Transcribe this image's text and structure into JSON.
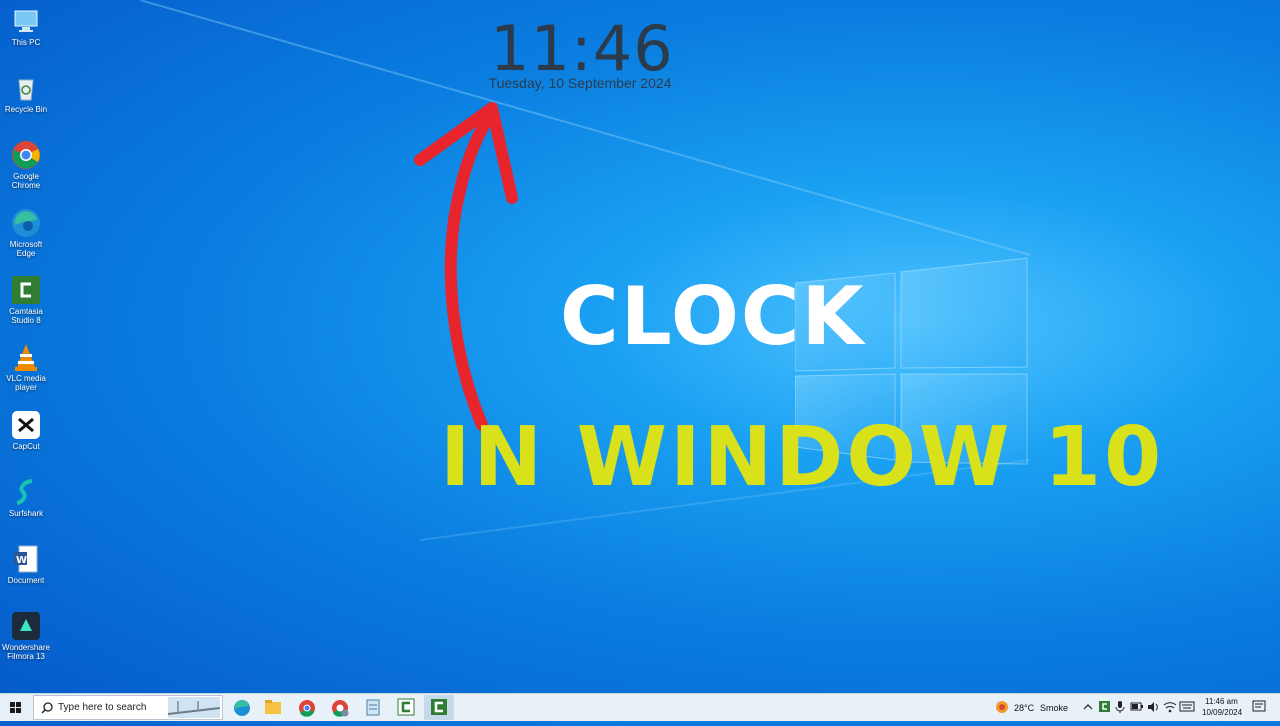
{
  "desktop": {
    "icons": [
      {
        "label": "This PC",
        "icon": "this-pc-icon"
      },
      {
        "label": "Recycle Bin",
        "icon": "recycle-bin-icon"
      },
      {
        "label": "Google\nChrome",
        "icon": "chrome-icon"
      },
      {
        "label": "Microsoft\nEdge",
        "icon": "edge-icon"
      },
      {
        "label": "Camtasia\nStudio 8",
        "icon": "camtasia-icon"
      },
      {
        "label": "VLC media\nplayer",
        "icon": "vlc-icon"
      },
      {
        "label": "CapCut",
        "icon": "capcut-icon"
      },
      {
        "label": "Surfshark",
        "icon": "surfshark-icon"
      },
      {
        "label": "Document",
        "icon": "word-document-icon"
      },
      {
        "label": "Wondershare\nFilmora 13",
        "icon": "filmora-icon"
      }
    ]
  },
  "clock_widget": {
    "time": "11:46",
    "date": "Tuesday, 10 September 2024"
  },
  "overlay": {
    "title": "CLOCK",
    "subtitle": "IN WINDOW 10",
    "title_color": "#ffffff",
    "subtitle_color": "#d9e11a",
    "arrow_color": "#e8242c"
  },
  "taskbar": {
    "search_placeholder": "Type here to search",
    "weather": {
      "temp": "28°C",
      "condition": "Smoke"
    },
    "time": "11:46 am",
    "date": "10/09/2024",
    "pinned": [
      "edge-icon",
      "file-explorer-icon",
      "chrome-icon",
      "chrome-profile-icon",
      "notepad-icon",
      "camtasia-icon",
      "camtasia-active-icon"
    ]
  }
}
